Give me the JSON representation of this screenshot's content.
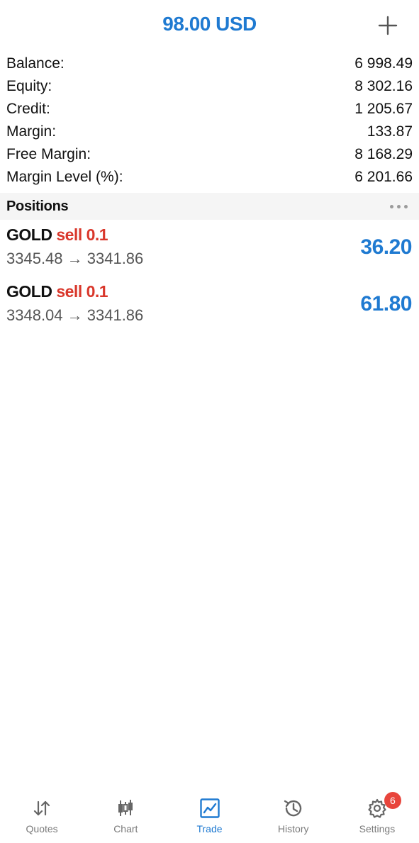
{
  "header": {
    "title": "98.00 USD",
    "add_icon": "plus-icon"
  },
  "summary": [
    {
      "label": "Balance:",
      "value": "6 998.49"
    },
    {
      "label": "Equity:",
      "value": "8 302.16"
    },
    {
      "label": "Credit:",
      "value": "1 205.67"
    },
    {
      "label": "Margin:",
      "value": "133.87"
    },
    {
      "label": "Free Margin:",
      "value": "8 168.29"
    },
    {
      "label": "Margin Level (%):",
      "value": "6 201.66"
    }
  ],
  "positions_section": {
    "title": "Positions",
    "more_icon": "more-dots-icon"
  },
  "positions": [
    {
      "symbol": "GOLD",
      "side": "sell 0.1",
      "prices": "3345.48 → 3341.86",
      "profit": "36.20"
    },
    {
      "symbol": "GOLD",
      "side": "sell 0.1",
      "prices": "3348.04 → 3341.86",
      "profit": "61.80"
    }
  ],
  "tabs": [
    {
      "label": "Quotes",
      "icon": "quotes-arrows-icon",
      "active": false
    },
    {
      "label": "Chart",
      "icon": "candlestick-chart-icon",
      "active": false
    },
    {
      "label": "Trade",
      "icon": "trade-chart-icon",
      "active": true
    },
    {
      "label": "History",
      "icon": "history-clock-icon",
      "active": false
    },
    {
      "label": "Settings",
      "icon": "gear-icon",
      "active": false,
      "badge": "6"
    }
  ],
  "colors": {
    "accent": "#1f7ad1",
    "sell": "#d9372b",
    "badge": "#e8453c",
    "section_bg": "#f5f5f5"
  }
}
